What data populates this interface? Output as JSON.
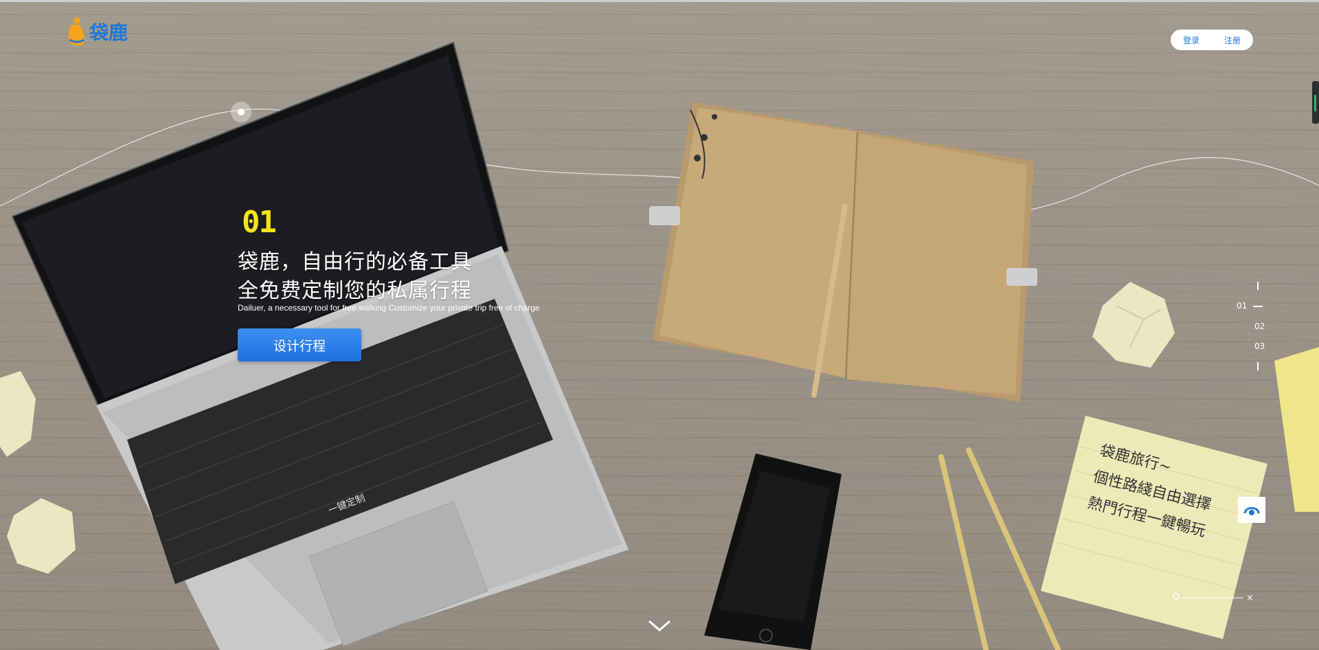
{
  "brand": {
    "name": "袋鹿"
  },
  "auth": {
    "login": "登录",
    "register": "注册"
  },
  "hero": {
    "index": "01",
    "line1": "袋鹿，自由行的必备工具",
    "line2": "全免费定制您的私属行程",
    "subtitle": "Dailuer, a necessary tool for free walking Customize your private trip free of charge",
    "cta": "设计行程"
  },
  "laptop": {
    "key_label": "一键定制"
  },
  "side_nav": {
    "items": [
      "01",
      "02",
      "03"
    ],
    "active": "01"
  },
  "sticky_note": {
    "line1": "袋鹿旅行~",
    "line2": "個性路綫自由選擇",
    "line3": "熱門行程一鍵暢玩"
  },
  "music": {
    "close": "×"
  },
  "colors": {
    "brand_blue": "#1e78d6",
    "accent_yellow": "#f7e318",
    "cta_blue": "#2a7ee9"
  }
}
